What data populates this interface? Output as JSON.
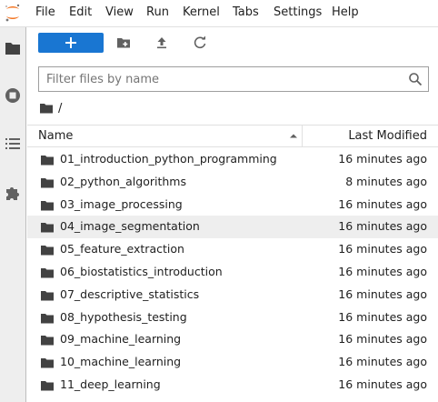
{
  "menu": {
    "file": "File",
    "edit": "Edit",
    "view": "View",
    "run": "Run",
    "kernel": "Kernel",
    "tabs": "Tabs",
    "settings": "Settings",
    "help": "Help"
  },
  "sidebar": {
    "icons": [
      "folder-icon",
      "running-icon",
      "table-of-contents-icon",
      "extension-icon"
    ]
  },
  "toolbar": {
    "new_launcher_icon": "plus-icon",
    "new_folder_icon": "new-folder-icon",
    "upload_icon": "upload-icon",
    "refresh_icon": "refresh-icon"
  },
  "filter": {
    "placeholder": "Filter files by name",
    "value": ""
  },
  "breadcrumb": {
    "separator": "/"
  },
  "list": {
    "header_name": "Name",
    "header_modified": "Last Modified",
    "sort_direction": "ascending",
    "rows": [
      {
        "name": "01_introduction_python_programming",
        "modified": "16 minutes ago"
      },
      {
        "name": "02_python_algorithms",
        "modified": "8 minutes ago"
      },
      {
        "name": "03_image_processing",
        "modified": "16 minutes ago"
      },
      {
        "name": "04_image_segmentation",
        "modified": "16 minutes ago"
      },
      {
        "name": "05_feature_extraction",
        "modified": "16 minutes ago"
      },
      {
        "name": "06_biostatistics_introduction",
        "modified": "16 minutes ago"
      },
      {
        "name": "07_descriptive_statistics",
        "modified": "16 minutes ago"
      },
      {
        "name": "08_hypothesis_testing",
        "modified": "16 minutes ago"
      },
      {
        "name": "09_machine_learning",
        "modified": "16 minutes ago"
      },
      {
        "name": "10_machine_learning",
        "modified": "16 minutes ago"
      },
      {
        "name": "11_deep_learning",
        "modified": "16 minutes ago"
      }
    ]
  },
  "colors": {
    "accent": "#1976d2",
    "logo": "#f37726",
    "hover_row": "#eeeeee",
    "sidebar_bg": "#eeeeee",
    "icon": "#616161"
  }
}
